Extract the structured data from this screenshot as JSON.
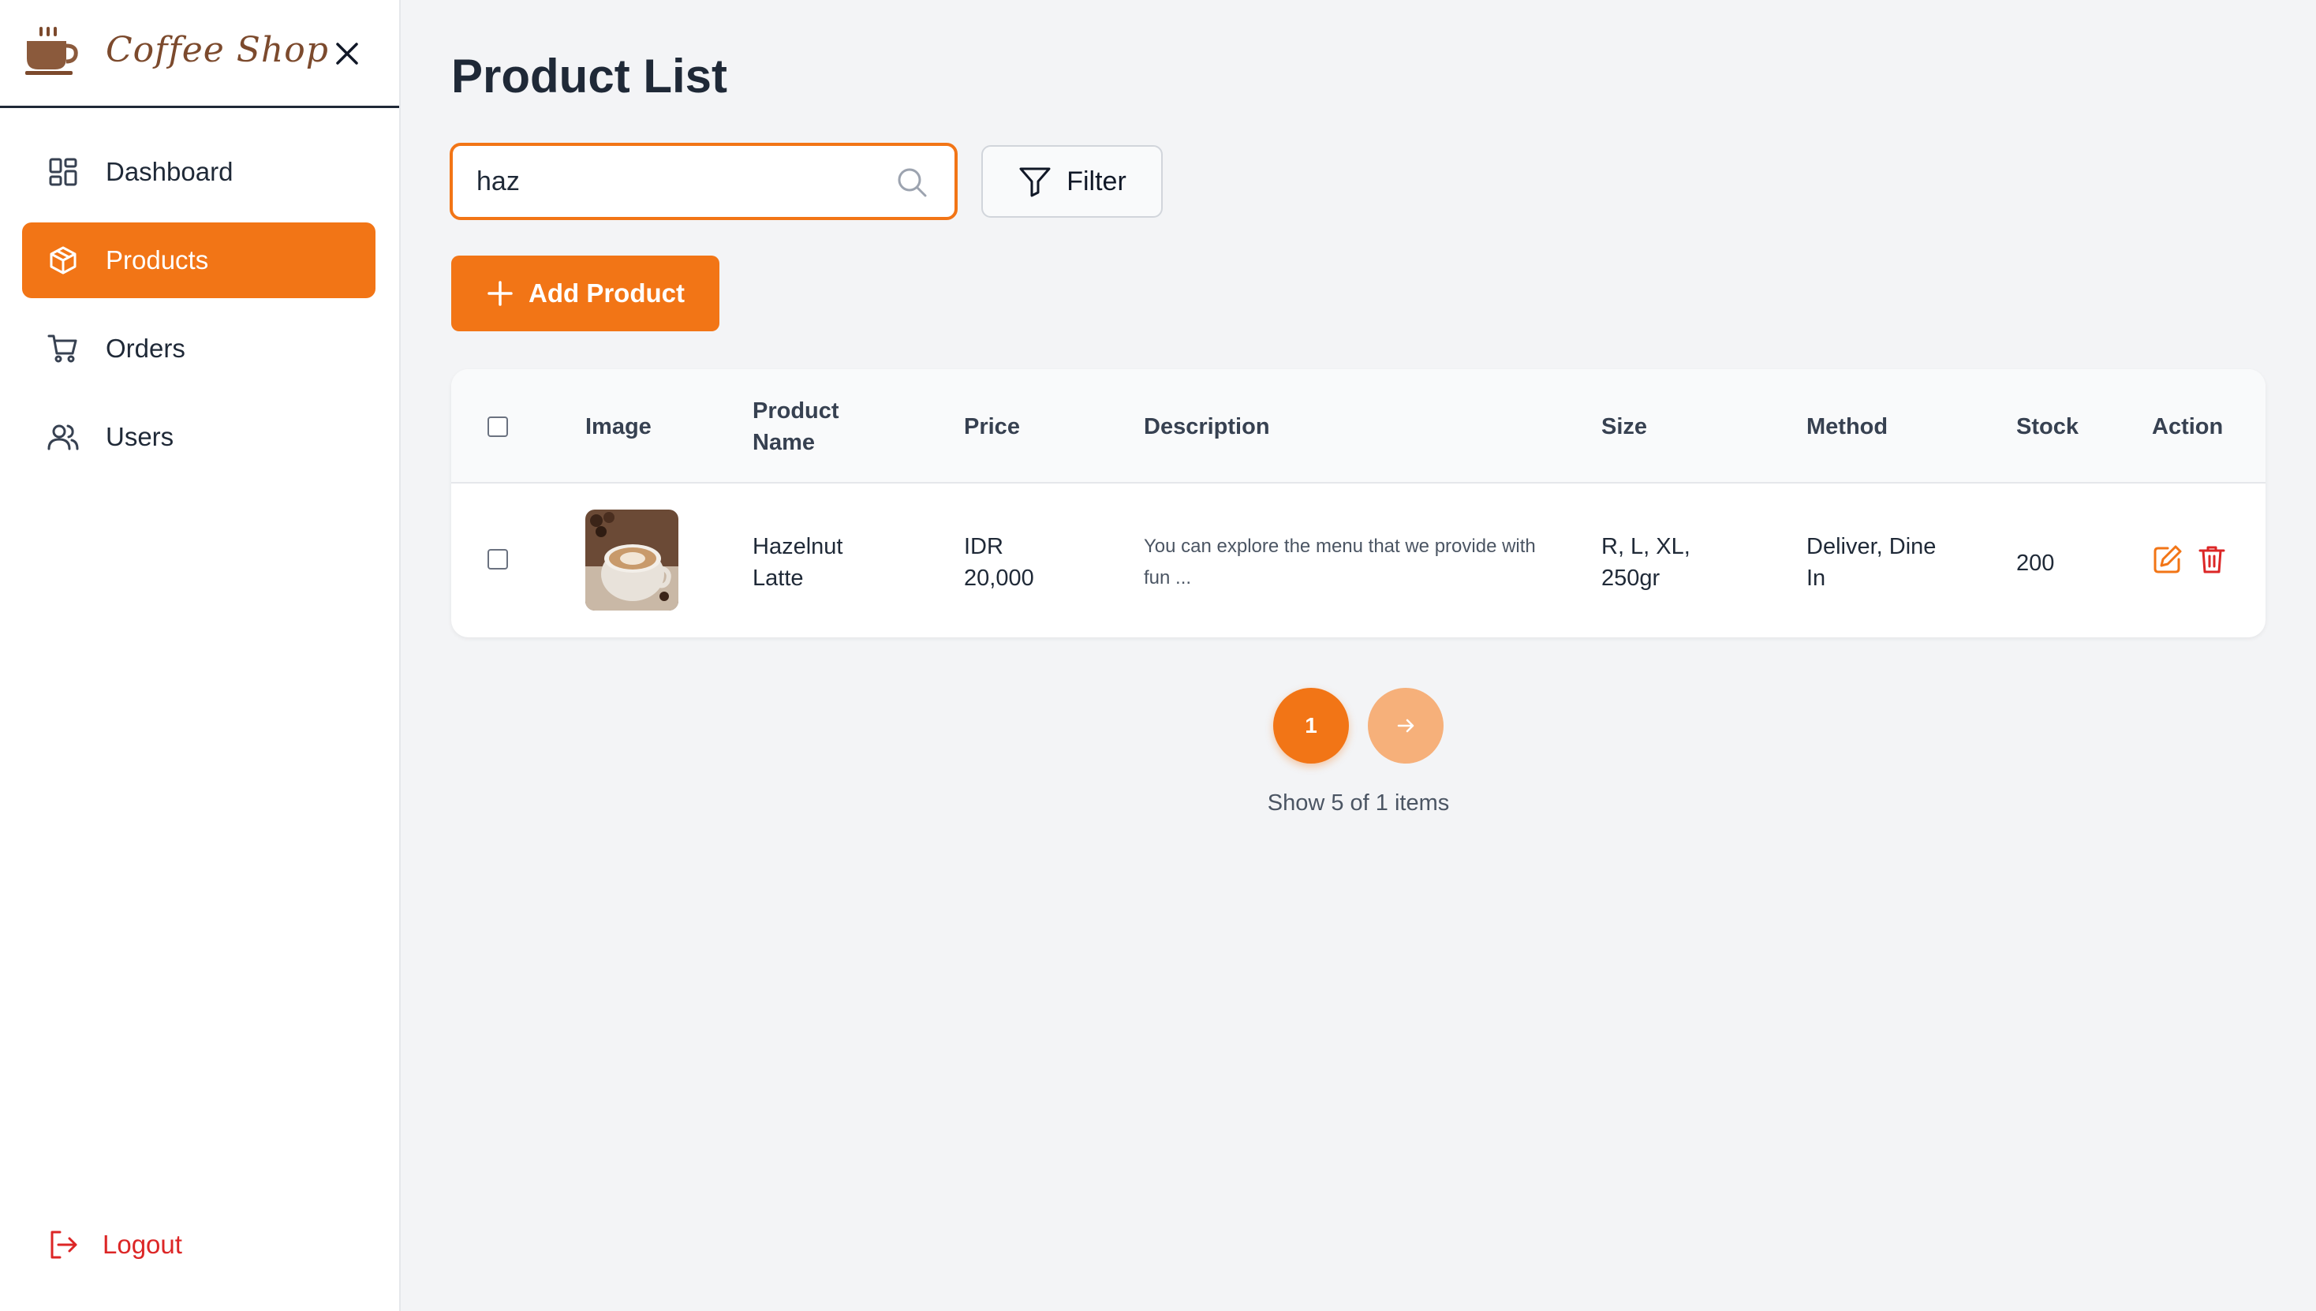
{
  "brand": {
    "name": "Coffee Shop"
  },
  "sidebar": {
    "items": [
      {
        "label": "Dashboard",
        "icon": "dashboard-icon",
        "active": false
      },
      {
        "label": "Products",
        "icon": "box-icon",
        "active": true
      },
      {
        "label": "Orders",
        "icon": "cart-icon",
        "active": false
      },
      {
        "label": "Users",
        "icon": "users-icon",
        "active": false
      }
    ],
    "logout_label": "Logout"
  },
  "main": {
    "title": "Product List",
    "search": {
      "value": "haz"
    },
    "filter_label": "Filter",
    "add_label": "Add Product"
  },
  "table": {
    "headers": [
      "Image",
      "Product Name",
      "Price",
      "Description",
      "Size",
      "Method",
      "Stock",
      "Action"
    ],
    "rows": [
      {
        "product_name": "Hazelnut Latte",
        "price": "IDR 20,000",
        "description": "You can explore the menu that we provide with fun ...",
        "size": "R, L, XL, 250gr",
        "method": "Deliver, Dine In",
        "stock": "200"
      }
    ]
  },
  "pagination": {
    "current_page": "1",
    "next_icon": "arrow-right-icon",
    "info": "Show 5 of 1 items"
  },
  "colors": {
    "accent": "#f27516",
    "accent_light": "#f6b07a",
    "danger": "#dc2626",
    "background": "#f3f4f6",
    "brand_text": "#7c4a2d"
  }
}
